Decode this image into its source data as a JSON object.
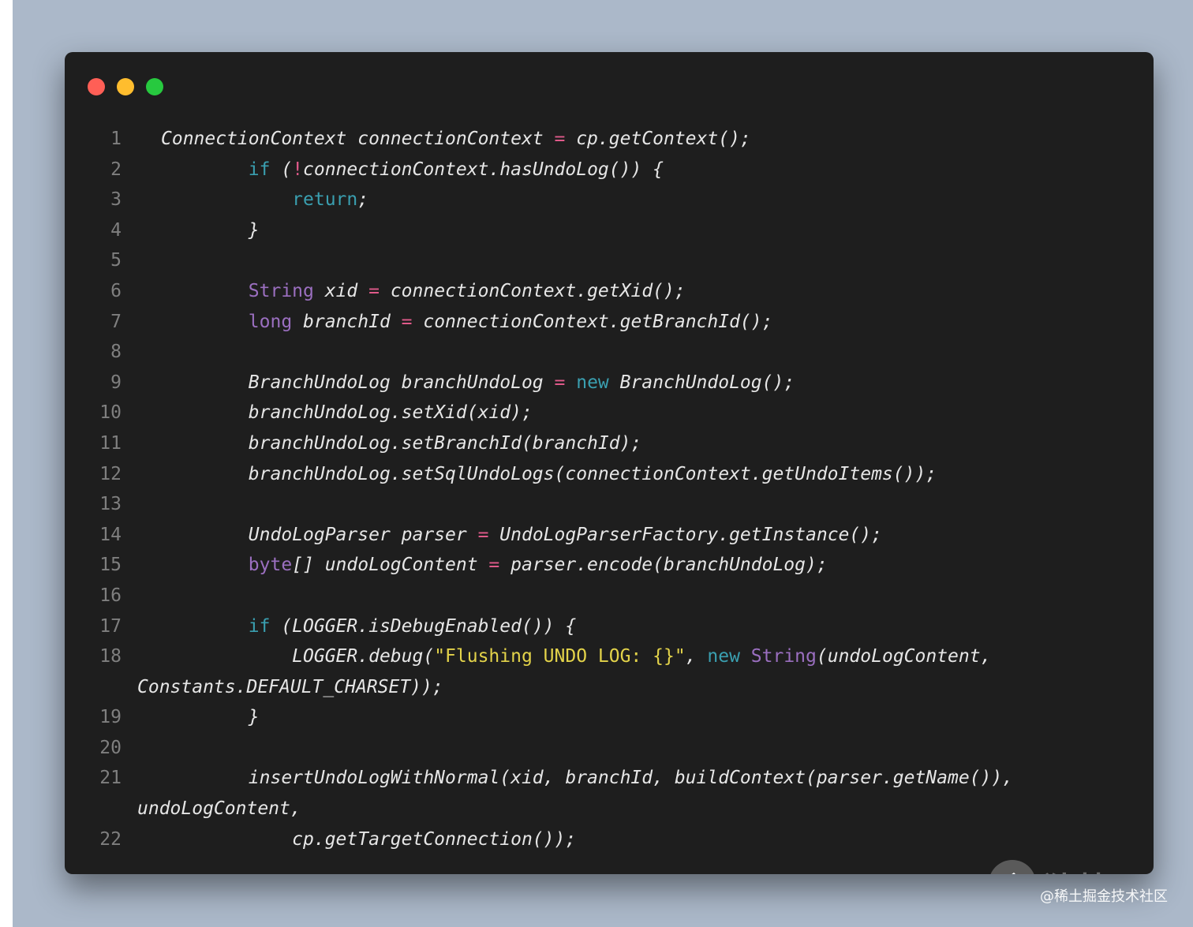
{
  "theme": {
    "backdrop": "#abb8c9",
    "window_bg": "#1e1e1e",
    "dot_colors": {
      "red": "#ff5f56",
      "yellow": "#ffbd2e",
      "green": "#27c93f"
    },
    "keyword_color": "#3a9fb0",
    "type_color": "#9b6fc0",
    "operator_color": "#e05a8a",
    "string_color": "#e3d34a"
  },
  "window": {
    "controls": [
      "close-dot",
      "minimize-dot",
      "maximize-dot"
    ]
  },
  "code": {
    "lines": [
      {
        "n": "1",
        "segments": [
          [
            "t",
            "ConnectionContext connectionContext "
          ],
          [
            "o",
            "="
          ],
          [
            "t",
            " cp.getContext();"
          ]
        ]
      },
      {
        "n": "2",
        "segments": [
          [
            "t",
            "        "
          ],
          [
            "k",
            "if"
          ],
          [
            "t",
            " ("
          ],
          [
            "o",
            "!"
          ],
          [
            "t",
            "connectionContext.hasUndoLog()) {"
          ]
        ]
      },
      {
        "n": "3",
        "segments": [
          [
            "t",
            "            "
          ],
          [
            "k",
            "return"
          ],
          [
            "t",
            ";"
          ]
        ]
      },
      {
        "n": "4",
        "segments": [
          [
            "t",
            "        }"
          ]
        ]
      },
      {
        "n": "5",
        "segments": []
      },
      {
        "n": "6",
        "segments": [
          [
            "t",
            "        "
          ],
          [
            "y",
            "String"
          ],
          [
            "t",
            " xid "
          ],
          [
            "o",
            "="
          ],
          [
            "t",
            " connectionContext.getXid();"
          ]
        ]
      },
      {
        "n": "7",
        "segments": [
          [
            "t",
            "        "
          ],
          [
            "y",
            "long"
          ],
          [
            "t",
            " branchId "
          ],
          [
            "o",
            "="
          ],
          [
            "t",
            " connectionContext.getBranchId();"
          ]
        ]
      },
      {
        "n": "8",
        "segments": []
      },
      {
        "n": "9",
        "segments": [
          [
            "t",
            "        BranchUndoLog branchUndoLog "
          ],
          [
            "o",
            "="
          ],
          [
            "t",
            " "
          ],
          [
            "k",
            "new"
          ],
          [
            "t",
            " BranchUndoLog();"
          ]
        ]
      },
      {
        "n": "10",
        "segments": [
          [
            "t",
            "        branchUndoLog.setXid(xid);"
          ]
        ]
      },
      {
        "n": "11",
        "segments": [
          [
            "t",
            "        branchUndoLog.setBranchId(branchId);"
          ]
        ]
      },
      {
        "n": "12",
        "segments": [
          [
            "t",
            "        branchUndoLog.setSqlUndoLogs(connectionContext.getUndoItems());"
          ]
        ]
      },
      {
        "n": "13",
        "segments": []
      },
      {
        "n": "14",
        "segments": [
          [
            "t",
            "        UndoLogParser parser "
          ],
          [
            "o",
            "="
          ],
          [
            "t",
            " UndoLogParserFactory.getInstance();"
          ]
        ]
      },
      {
        "n": "15",
        "segments": [
          [
            "t",
            "        "
          ],
          [
            "y",
            "byte"
          ],
          [
            "t",
            "[] undoLogContent "
          ],
          [
            "o",
            "="
          ],
          [
            "t",
            " parser.encode(branchUndoLog);"
          ]
        ]
      },
      {
        "n": "16",
        "segments": []
      },
      {
        "n": "17",
        "segments": [
          [
            "t",
            "        "
          ],
          [
            "k",
            "if"
          ],
          [
            "t",
            " (LOGGER.isDebugEnabled()) {"
          ]
        ]
      },
      {
        "n": "18",
        "segments": [
          [
            "t",
            "            LOGGER.debug("
          ],
          [
            "s",
            "\"Flushing UNDO LOG: {}\""
          ],
          [
            "t",
            ", "
          ],
          [
            "k",
            "new"
          ],
          [
            "t",
            " "
          ],
          [
            "y",
            "String"
          ],
          [
            "t",
            "(undoLogContent,"
          ]
        ],
        "cont": "Constants.DEFAULT_CHARSET));"
      },
      {
        "n": "19",
        "segments": [
          [
            "t",
            "        }"
          ]
        ]
      },
      {
        "n": "20",
        "segments": []
      },
      {
        "n": "21",
        "segments": [
          [
            "t",
            "        insertUndoLogWithNormal(xid, branchId, buildContext(parser.getName()),"
          ]
        ],
        "cont": "undoLogContent,"
      },
      {
        "n": "22",
        "segments": [
          [
            "t",
            "            cp.getTargetConnection());"
          ]
        ]
      }
    ]
  },
  "watermark": {
    "icon": "hammer-icon",
    "text": "独特工具箱"
  },
  "credit": "@稀土掘金技术社区"
}
